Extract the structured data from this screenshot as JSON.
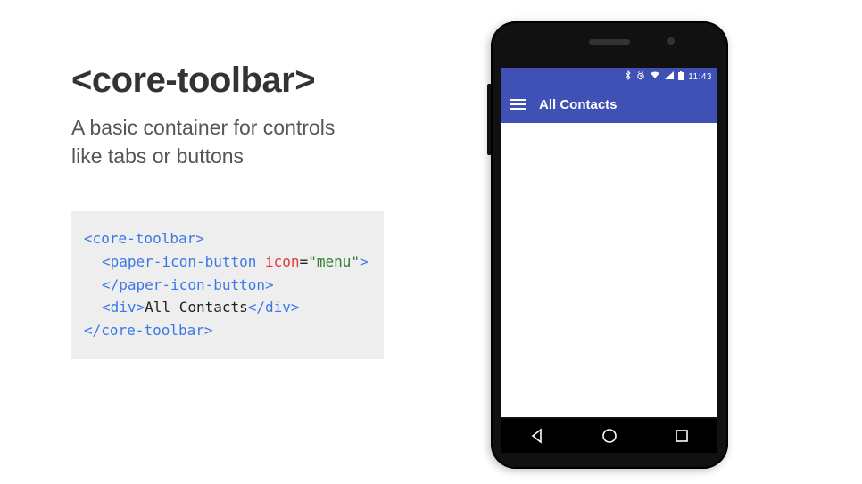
{
  "heading": "<core-toolbar>",
  "subtitle_l1": "A basic container for controls",
  "subtitle_l2": "like tabs or buttons",
  "code": {
    "l1_open": "<core-toolbar>",
    "l2_tag_open": "<paper-icon-button",
    "l2_attr": " icon",
    "l2_eq": "=",
    "l2_val": "\"menu\"",
    "l2_close": ">",
    "l3": "</paper-icon-button>",
    "l4_open": "<div>",
    "l4_text": "All Contacts",
    "l4_close": "</div>",
    "l5": "</core-toolbar>"
  },
  "phone": {
    "status": {
      "clock": "11:43"
    },
    "appbar": {
      "title": "All Contacts"
    }
  }
}
